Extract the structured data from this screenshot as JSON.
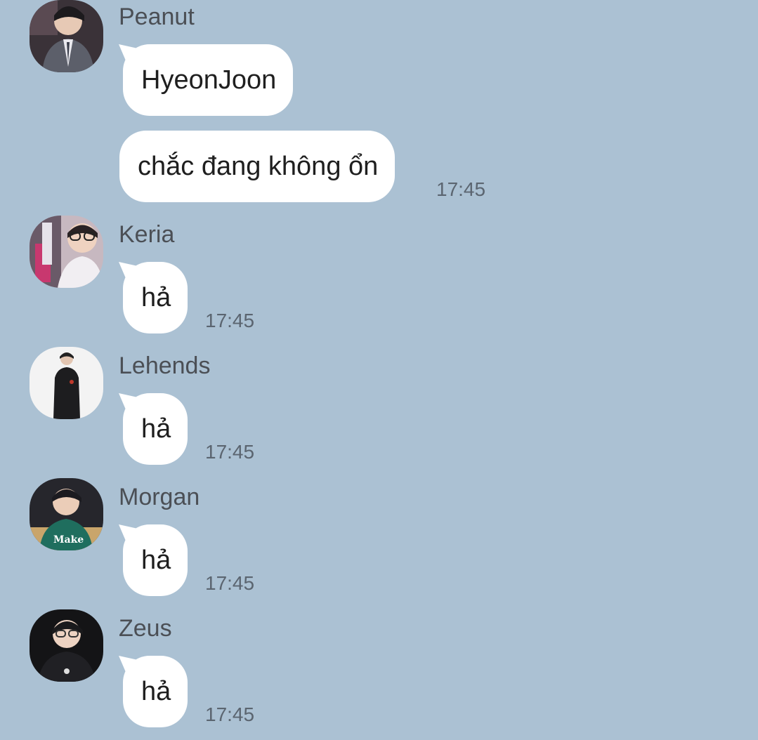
{
  "messages": [
    {
      "sender": "Peanut",
      "text": "HyeonJoon"
    },
    {
      "text": "chắc đang không ổn",
      "time": "17:45"
    },
    {
      "sender": "Keria",
      "text": "hả",
      "time": "17:45"
    },
    {
      "sender": "Lehends",
      "text": "hả",
      "time": "17:45"
    },
    {
      "sender": "Morgan",
      "text": "hả",
      "time": "17:45"
    },
    {
      "sender": "Zeus",
      "text": "hả",
      "time": "17:45"
    }
  ]
}
